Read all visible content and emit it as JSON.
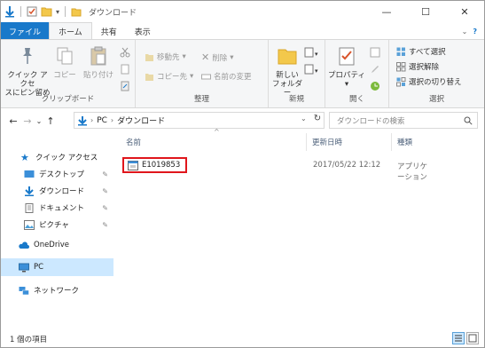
{
  "title": "ダウンロード",
  "tabs": {
    "file": "ファイル",
    "home": "ホーム",
    "share": "共有",
    "view": "表示"
  },
  "ribbon": {
    "clipboard": {
      "label": "クリップボード",
      "pin": "クイック アクセス にピン留め",
      "pin_l1": "クイック アクセ",
      "pin_l2": "スにピン留め",
      "copy": "コピー",
      "paste": "貼り付け"
    },
    "organize": {
      "label": "整理",
      "move": "移動先",
      "copy_to": "コピー先",
      "delete": "削除",
      "rename": "名前の変更"
    },
    "new": {
      "label": "新規",
      "folder_l1": "新しい",
      "folder_l2": "フォルダー"
    },
    "open": {
      "label": "開く",
      "properties": "プロパティ"
    },
    "select": {
      "label": "選択",
      "all": "すべて選択",
      "none": "選択解除",
      "invert": "選択の切り替え"
    }
  },
  "address": {
    "pc": "PC",
    "folder": "ダウンロード",
    "search_placeholder": "ダウンロードの検索"
  },
  "nav": {
    "quick_access": "クイック アクセス",
    "desktop": "デスクトップ",
    "downloads": "ダウンロード",
    "documents": "ドキュメント",
    "pictures": "ピクチャ",
    "onedrive": "OneDrive",
    "pc": "PC",
    "network": "ネットワーク"
  },
  "columns": {
    "name": "名前",
    "date": "更新日時",
    "type": "種類"
  },
  "files": [
    {
      "name": "E1019853",
      "date": "2017/05/22 12:12",
      "type": "アプリケーション"
    }
  ],
  "status": "1 個の項目",
  "colors": {
    "accent": "#1979ca",
    "highlight": "#e0161c",
    "selection": "#cce8ff"
  }
}
